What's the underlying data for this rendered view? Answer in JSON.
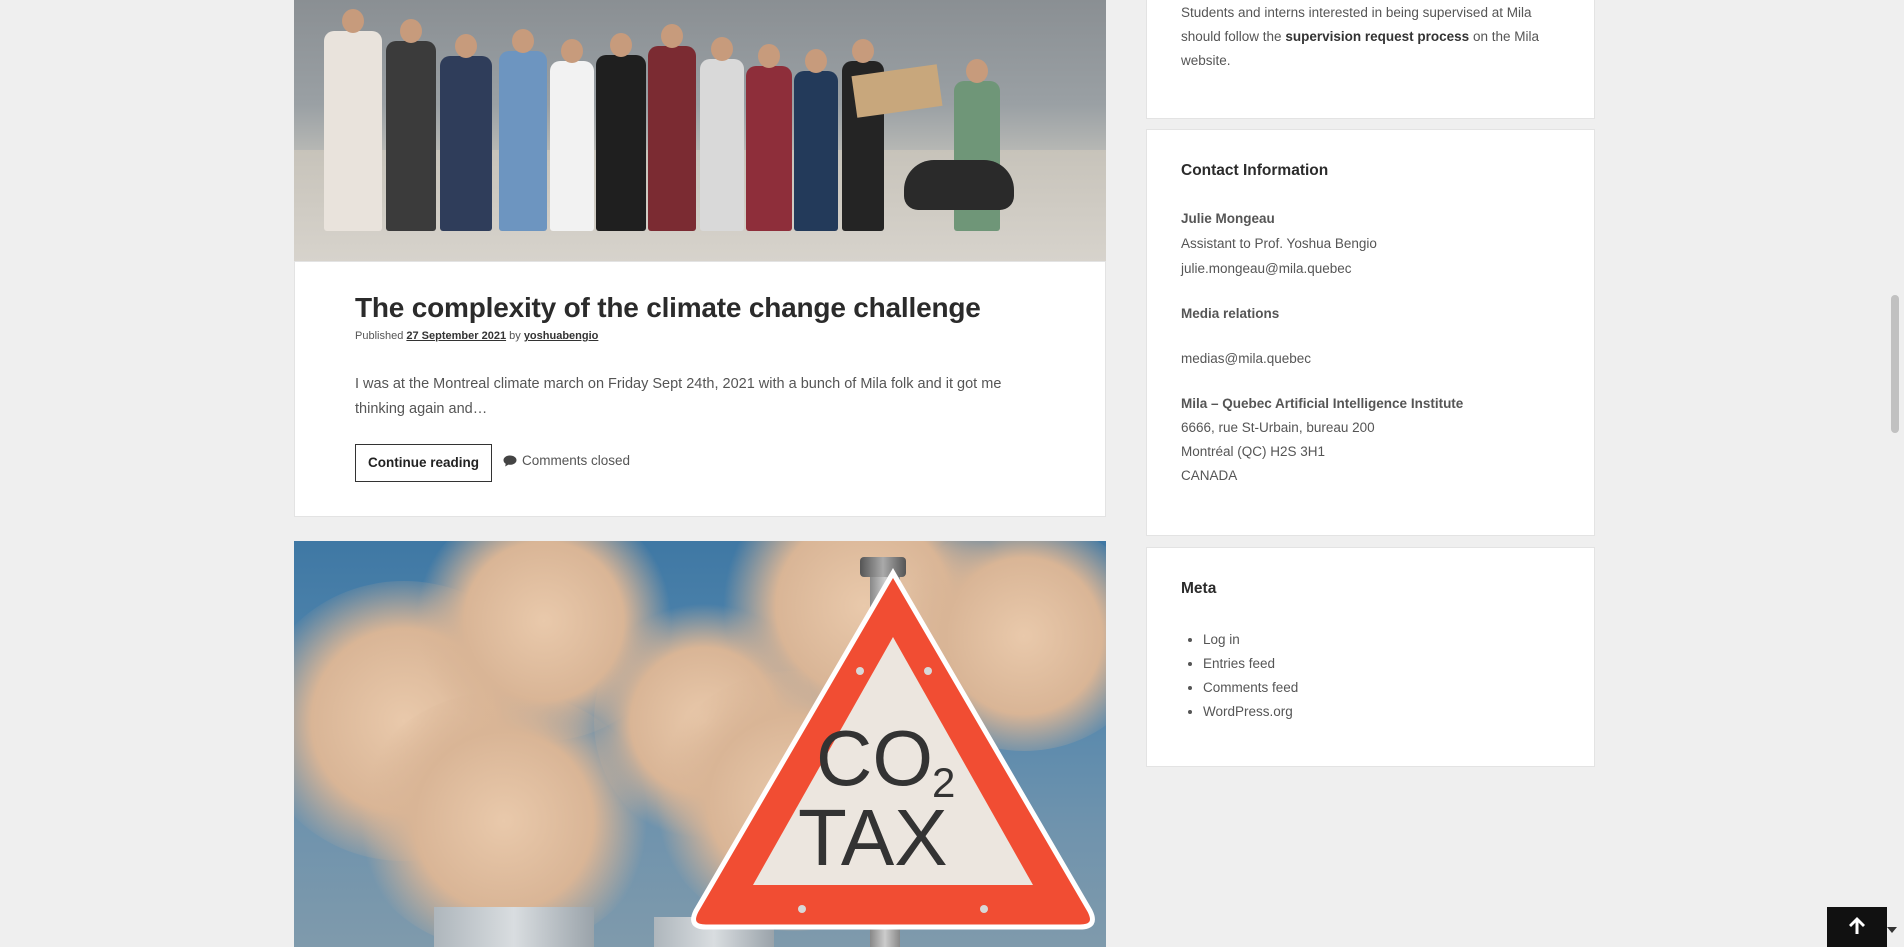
{
  "colors": {
    "page_bg": "#efefef",
    "card_bg": "#ffffff",
    "title": "#2b2b2b",
    "body_text": "#555555",
    "sign_red": "#ee4b32"
  },
  "posts": [
    {
      "title": "The complexity of the climate change challenge",
      "published_label": "Published",
      "date": "27 September 2021",
      "by_label": "by",
      "author": "yoshuabengio",
      "excerpt": "I was at the Montreal climate march on Friday Sept 24th, 2021 with a bunch of Mila folk and it got me thinking again and…",
      "continue_label": "Continue reading",
      "comments_label": "Comments closed",
      "image_icon": "climate-march-crowd-photo"
    },
    {
      "image_icon": "co2-tax-warning-sign-photo",
      "sign_text_top": "CO",
      "sign_text_sub": "2",
      "sign_text_bottom": "TAX"
    }
  ],
  "sidebar": {
    "supervision": {
      "text_before": "Students and interns interested in being supervised at Mila should follow the",
      "link": "supervision request process",
      "text_after": "on the Mila website."
    },
    "contact": {
      "title": "Contact Information",
      "person_name": "Julie Mongeau",
      "person_role": "Assistant to Prof. Yoshua Bengio",
      "person_email": "julie.mongeau@mila.quebec",
      "media_title": "Media relations",
      "media_email": "medias@mila.quebec",
      "org_name": "Mila – Quebec Artificial Intelligence Institute",
      "address_line1": "6666, rue St-Urbain, bureau 200",
      "address_line2": "Montréal (QC) H2S 3H1",
      "address_line3": "CANADA"
    },
    "meta": {
      "title": "Meta",
      "items": [
        {
          "label": "Log in"
        },
        {
          "label": "Entries feed"
        },
        {
          "label": "Comments feed"
        },
        {
          "label": "WordPress.org"
        }
      ]
    }
  },
  "back_to_top_icon": "arrow-up-icon"
}
